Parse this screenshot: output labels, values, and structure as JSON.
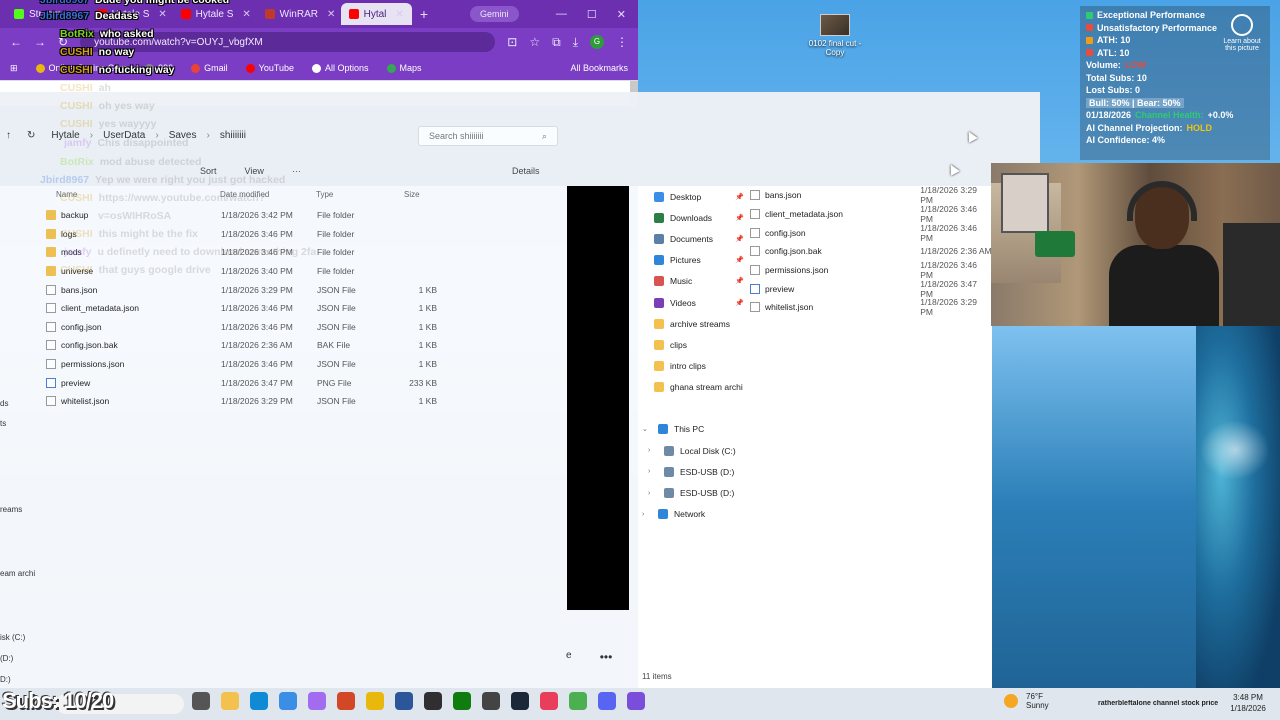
{
  "desktop": {
    "icon_label": "0102 final cut - Copy"
  },
  "browser": {
    "tabs": [
      {
        "label": "Stream",
        "color": "#53fc18"
      },
      {
        "label": "Hytale S",
        "color": "#ff0000"
      },
      {
        "label": "Hytale S",
        "color": "#ff0000"
      },
      {
        "label": "WinRAR",
        "color": "#c0392b"
      },
      {
        "label": "Hytal",
        "color": "#ff0000"
      }
    ],
    "gemini_label": "Gemini",
    "url": "youtube.com/watch?v=OUYJ_vbgfXM",
    "bookmarks": [
      "Online Casino Gam",
      "990",
      "Gmail",
      "YouTube",
      "All Options",
      "Maps"
    ],
    "all_bookmarks": "All Bookmarks",
    "profile_initial": "G"
  },
  "explorer1": {
    "breadcrumb": [
      "Hytale",
      "UserData",
      "Saves",
      "shiiiiiii"
    ],
    "search_placeholder": "Search shiiiiiii",
    "toolbar": {
      "sort": "Sort",
      "view": "View",
      "more": "···",
      "details": "Details"
    },
    "columns": {
      "name": "Name",
      "date": "Date modified",
      "type": "Type",
      "size": "Size"
    },
    "files": [
      {
        "name": "backup",
        "date": "1/18/2026 3:42 PM",
        "type": "File folder",
        "size": "",
        "kind": "folder"
      },
      {
        "name": "logs",
        "date": "1/18/2026 3:46 PM",
        "type": "File folder",
        "size": "",
        "kind": "folder"
      },
      {
        "name": "mods",
        "date": "1/18/2026 3:46 PM",
        "type": "File folder",
        "size": "",
        "kind": "folder"
      },
      {
        "name": "universe",
        "date": "1/18/2026 3:40 PM",
        "type": "File folder",
        "size": "",
        "kind": "folder"
      },
      {
        "name": "bans.json",
        "date": "1/18/2026 3:29 PM",
        "type": "JSON File",
        "size": "1 KB",
        "kind": "file"
      },
      {
        "name": "client_metadata.json",
        "date": "1/18/2026 3:46 PM",
        "type": "JSON File",
        "size": "1 KB",
        "kind": "file"
      },
      {
        "name": "config.json",
        "date": "1/18/2026 3:46 PM",
        "type": "JSON File",
        "size": "1 KB",
        "kind": "file"
      },
      {
        "name": "config.json.bak",
        "date": "1/18/2026 2:36 AM",
        "type": "BAK File",
        "size": "1 KB",
        "kind": "file"
      },
      {
        "name": "permissions.json",
        "date": "1/18/2026 3:46 PM",
        "type": "JSON File",
        "size": "1 KB",
        "kind": "file"
      },
      {
        "name": "preview",
        "date": "1/18/2026 3:47 PM",
        "type": "PNG File",
        "size": "233 KB",
        "kind": "png"
      },
      {
        "name": "whitelist.json",
        "date": "1/18/2026 3:29 PM",
        "type": "JSON File",
        "size": "1 KB",
        "kind": "file"
      }
    ],
    "left_cut": [
      "ds",
      "ts",
      "reams",
      "eam archi",
      "isk (C:)",
      "(D:)",
      "D:)"
    ]
  },
  "explorer2": {
    "quick_access": [
      {
        "label": "Desktop",
        "color": "#3a8ee6",
        "pinned": true
      },
      {
        "label": "Downloads",
        "color": "#2d7d46",
        "pinned": true
      },
      {
        "label": "Documents",
        "color": "#5b7fa6",
        "pinned": true
      },
      {
        "label": "Pictures",
        "color": "#2f86d9",
        "pinned": true
      },
      {
        "label": "Music",
        "color": "#d9534f",
        "pinned": true
      },
      {
        "label": "Videos",
        "color": "#7b3fb5",
        "pinned": true
      },
      {
        "label": "archive streams",
        "color": "#f2c14e",
        "pinned": false
      },
      {
        "label": "clips",
        "color": "#f2c14e",
        "pinned": false
      },
      {
        "label": "intro clips",
        "color": "#f2c14e",
        "pinned": false
      },
      {
        "label": "ghana stream archi",
        "color": "#f2c14e",
        "pinned": false
      }
    ],
    "tree": [
      {
        "label": "This PC",
        "color": "#2f86d9",
        "expanded": true
      },
      {
        "label": "Local Disk (C:)",
        "color": "#6f8aa6",
        "expanded": false
      },
      {
        "label": "ESD-USB (D:)",
        "color": "#6f8aa6",
        "expanded": false
      },
      {
        "label": "ESD-USB (D:)",
        "color": "#6f8aa6",
        "expanded": false
      },
      {
        "label": "Network",
        "color": "#2f86d9",
        "expanded": false
      }
    ],
    "files": [
      {
        "name": "bans.json",
        "date": "1/18/2026 3:29 PM",
        "kind": "file"
      },
      {
        "name": "client_metadata.json",
        "date": "1/18/2026 3:46 PM",
        "kind": "file"
      },
      {
        "name": "config.json",
        "date": "1/18/2026 3:46 PM",
        "kind": "file"
      },
      {
        "name": "config.json.bak",
        "date": "1/18/2026 2:36 AM",
        "kind": "file"
      },
      {
        "name": "permissions.json",
        "date": "1/18/2026 3:46 PM",
        "kind": "file"
      },
      {
        "name": "preview",
        "date": "1/18/2026 3:47 PM",
        "kind": "png"
      },
      {
        "name": "whitelist.json",
        "date": "1/18/2026 3:29 PM",
        "kind": "file"
      }
    ],
    "item_count": "11 items"
  },
  "stats": {
    "lines": [
      {
        "text": "Exceptional Performance",
        "marker": "#2ecc71"
      },
      {
        "text": "Unsatisfactory Performance",
        "marker": "#e74c3c"
      },
      {
        "text": "ATH: 10",
        "marker": "#f39c12"
      },
      {
        "text": "ATL: 10",
        "marker": "#e74c3c"
      },
      {
        "text": "Volume:",
        "marker": "",
        "extra": "LOW",
        "extra_color": "#e74c3c"
      },
      {
        "text": "Total Subs: 10",
        "marker": ""
      },
      {
        "text": "Lost Subs: 0",
        "marker": ""
      },
      {
        "text": "Bull: 50% | Bear: 50%",
        "marker": ""
      },
      {
        "text": "01/18/2026",
        "marker": "",
        "extra": "Channel Health:",
        "extra_color": "#2ecc71",
        "extra2": "+0.0%"
      },
      {
        "text": "AI Channel Projection:",
        "marker": "",
        "extra": "HOLD",
        "extra_color": "#f1c40f"
      },
      {
        "text": "AI Confidence: 4%",
        "marker": ""
      }
    ],
    "learn": "Learn about this picture"
  },
  "chat": [
    {
      "user": "Jbird8967",
      "text": "Dude you might be cooked",
      "color": "#3a6fd8",
      "faded": false
    },
    {
      "user": "Jbird8967",
      "text": "Deadass",
      "color": "#3a6fd8",
      "faded": false
    },
    {
      "user": "BotRix",
      "text": "who asked",
      "color": "#7ed321",
      "faded": false
    },
    {
      "user": "CUSHI",
      "text": "no way",
      "color": "#d4a017",
      "faded": false
    },
    {
      "user": "CUSHI",
      "text": "no fucking way",
      "color": "#d4a017",
      "faded": false
    },
    {
      "user": "CUSHI",
      "text": "ah",
      "color": "#d4a017",
      "faded": true
    },
    {
      "user": "CUSHI",
      "text": "oh yes way",
      "color": "#d4a017",
      "faded": true
    },
    {
      "user": "CUSHI",
      "text": "yes wayyyy",
      "color": "#d4a017",
      "faded": true
    },
    {
      "user": "jamfy",
      "text": "Chis disappointed",
      "color": "#b069e8",
      "faded": true
    },
    {
      "user": "BotRix",
      "text": "mod abuse detected",
      "color": "#7ed321",
      "faded": true
    },
    {
      "user": "Jbird8967",
      "text": "Yep we were right you just got hacked",
      "color": "#3a6fd8",
      "faded": true
    },
    {
      "user": "CUSHI",
      "text": "https://www.youtube.com/watch?",
      "color": "#d4a017",
      "faded": true
    },
    {
      "user": "",
      "text": "v=osWIHRoSA",
      "color": "#d4a017",
      "faded": true
    },
    {
      "user": "CUSHI",
      "text": "this might be the fix",
      "color": "#d4a017",
      "faded": true
    },
    {
      "user": "jamfy",
      "text": "u definetly need to download something 2fa",
      "color": "#b069e8",
      "faded": true
    },
    {
      "user": "CUSHI",
      "text": "that guys google drive",
      "color": "#d4a017",
      "faded": true
    }
  ],
  "taskbar": {
    "subs": "Subs: 10/20",
    "weather_temp": "76°F",
    "weather_desc": "Sunny",
    "ticker": "ratherbleftalone channel stock price",
    "time": "3:48 PM",
    "date": "1/18/2026",
    "icons": [
      {
        "name": "task-view-icon",
        "color": "#555"
      },
      {
        "name": "file-explorer-icon",
        "color": "#f2c14e"
      },
      {
        "name": "edge-icon",
        "color": "#0f8bd6"
      },
      {
        "name": "store-icon",
        "color": "#3a8ee6"
      },
      {
        "name": "app-icon",
        "color": "#a26bf0"
      },
      {
        "name": "office-icon",
        "color": "#d24726"
      },
      {
        "name": "chrome-icon",
        "color": "#e8b80d"
      },
      {
        "name": "word-icon",
        "color": "#2b579a"
      },
      {
        "name": "obs-icon",
        "color": "#302e31"
      },
      {
        "name": "xbox-icon",
        "color": "#107c10"
      },
      {
        "name": "app-icon",
        "color": "#444"
      },
      {
        "name": "steam-icon",
        "color": "#1b2838"
      },
      {
        "name": "app-icon",
        "color": "#e83e5c"
      },
      {
        "name": "chrome-icon",
        "color": "#4caf50"
      },
      {
        "name": "discord-icon",
        "color": "#5865f2"
      },
      {
        "name": "app-icon",
        "color": "#7a4ddb"
      }
    ]
  }
}
